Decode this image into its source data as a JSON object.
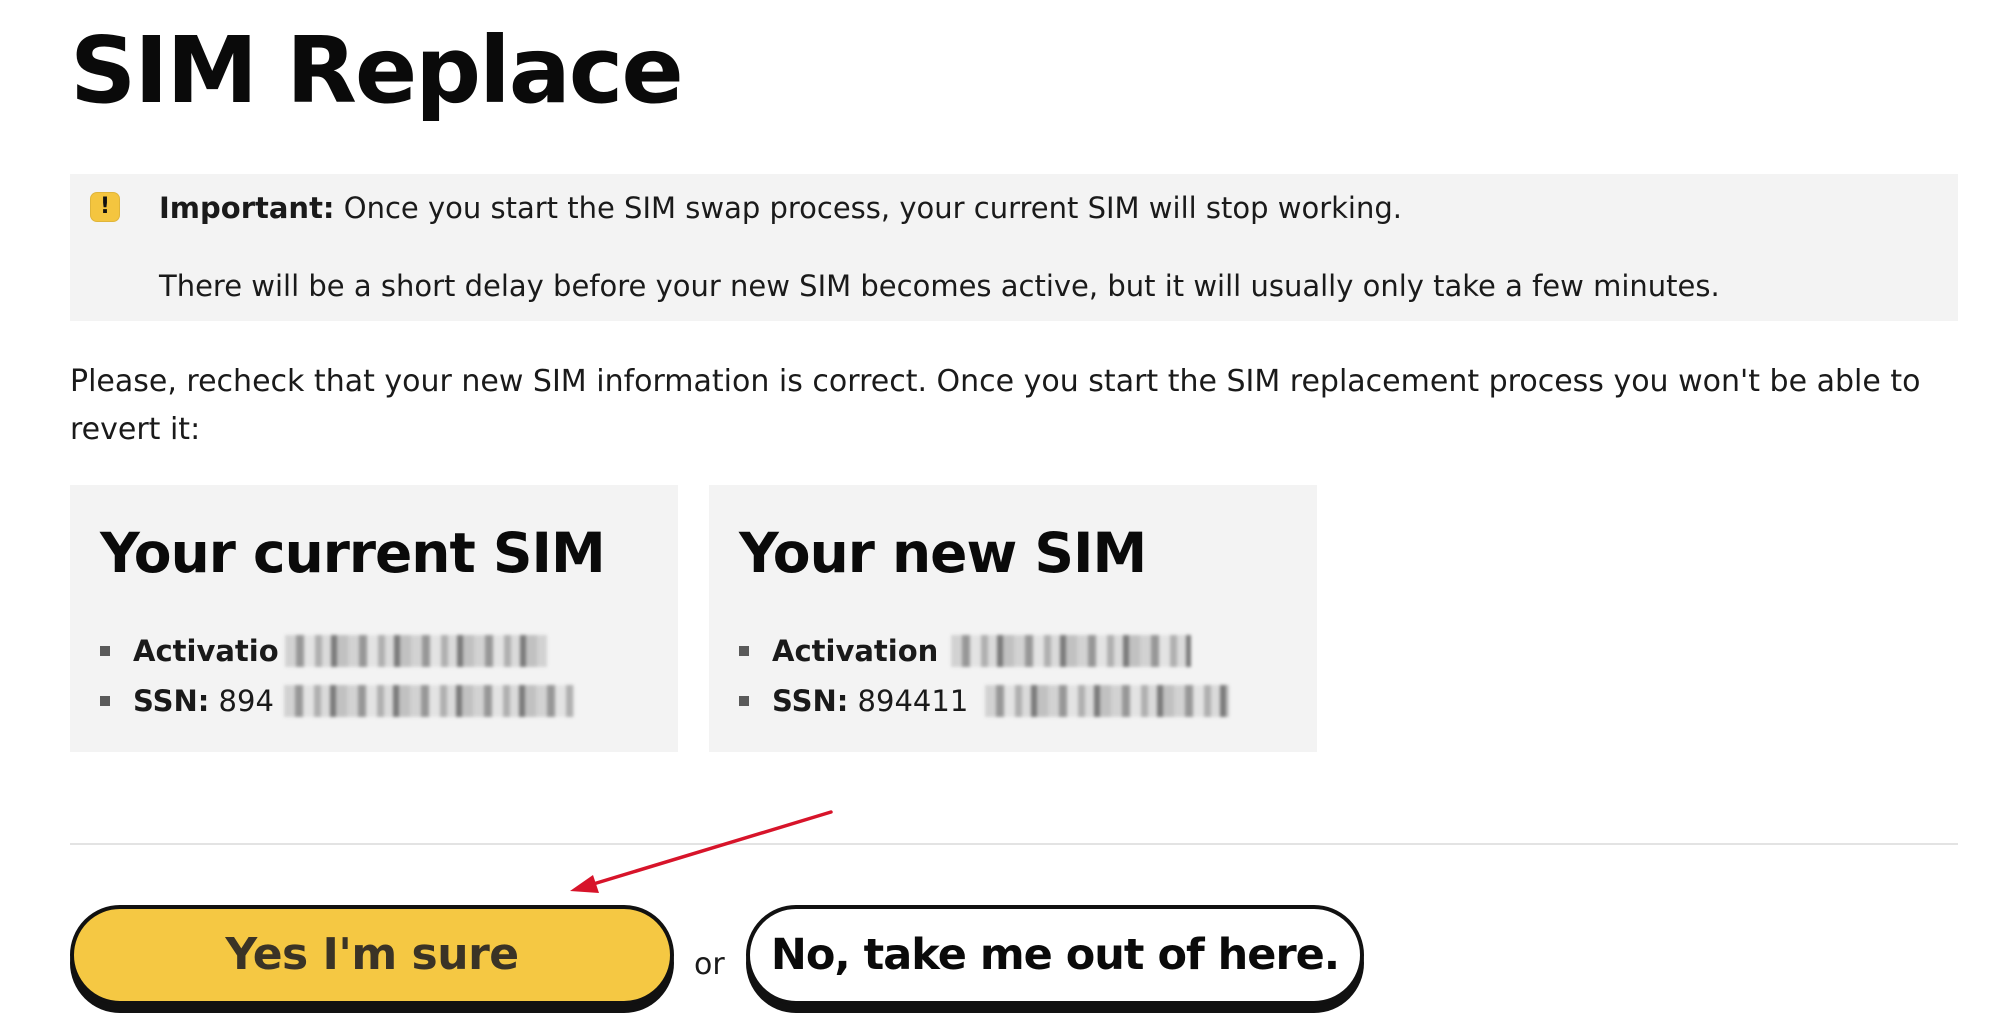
{
  "page": {
    "title": "SIM Replace"
  },
  "notice": {
    "icon": "exclamation-icon",
    "icon_glyph": "!",
    "icon_color": "#f4c53f",
    "strong": "Important:",
    "line1": " Once you start the SIM swap process, your current SIM will stop working.",
    "line2": "There will be a short delay before your new SIM becomes active, but it will usually only take a few minutes."
  },
  "intro": "Please, recheck that your new SIM information is correct. Once you start the SIM replacement process you won't be able to revert it:",
  "current_sim": {
    "title": "Your current SIM",
    "activation_label": "Activatio",
    "ssn_label": "SSN:",
    "ssn_value": " 894"
  },
  "new_sim": {
    "title": "Your new SIM",
    "activation_label": "Activation",
    "ssn_label": "SSN:",
    "ssn_value": " 894411"
  },
  "actions": {
    "confirm_label": "Yes I'm sure",
    "or_label": "or",
    "cancel_label": "No, take me out of here."
  },
  "annotation": {
    "arrow_color": "#d7142a"
  },
  "colors": {
    "accent": "#f5c843",
    "panel_bg": "#f3f3f3",
    "text": "#1a1a1a"
  }
}
